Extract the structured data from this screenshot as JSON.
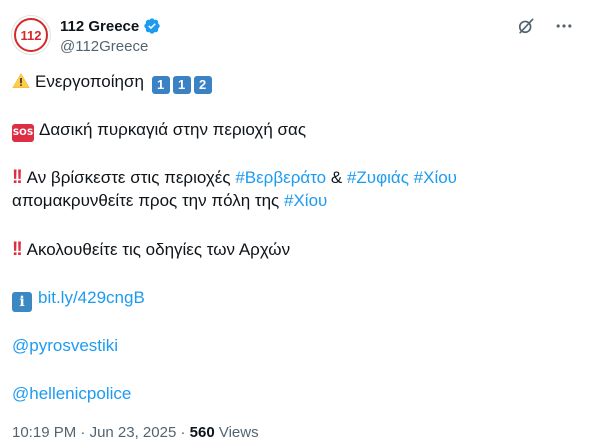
{
  "account": {
    "display_name": "112 Greece",
    "handle": "@112Greece",
    "avatar_text": "112"
  },
  "icons": {
    "verified": "verified-badge-icon",
    "grok": "grok-icon",
    "more": "more-icon"
  },
  "body": {
    "line1_text": "Ενεργοποίηση",
    "line1_keycaps": [
      "1",
      "1",
      "2"
    ],
    "sos_label": "SOS",
    "line2_text": "Δασική πυρκαγιά στην περιοχή σας",
    "line3_prefix": "Αν βρίσκεστε στις περιοχές",
    "tag_ververato": "#Βερβεράτο",
    "amp": "&",
    "tag_zyfias": "#Ζυφιάς",
    "tag_chiou": "#Χίου",
    "line4_text": "απομακρυνθείτε προς την πόλη της",
    "line5_text": "Ακολουθείτε τις οδηγίες των Αρχών",
    "info_label": "i",
    "link": "bit.ly/429cngB",
    "mention_1": "@pyrosvestiki",
    "mention_2": "@hellenicpolice"
  },
  "meta": {
    "time": "10:19 PM",
    "date": "Jun 23, 2025",
    "views_count": "560",
    "views_label": "Views"
  },
  "colors": {
    "link": "#1d9bf0",
    "muted": "#536471",
    "text": "#0f1419",
    "alert_red": "#dd2e44",
    "keycap_blue": "#3b82c4"
  }
}
